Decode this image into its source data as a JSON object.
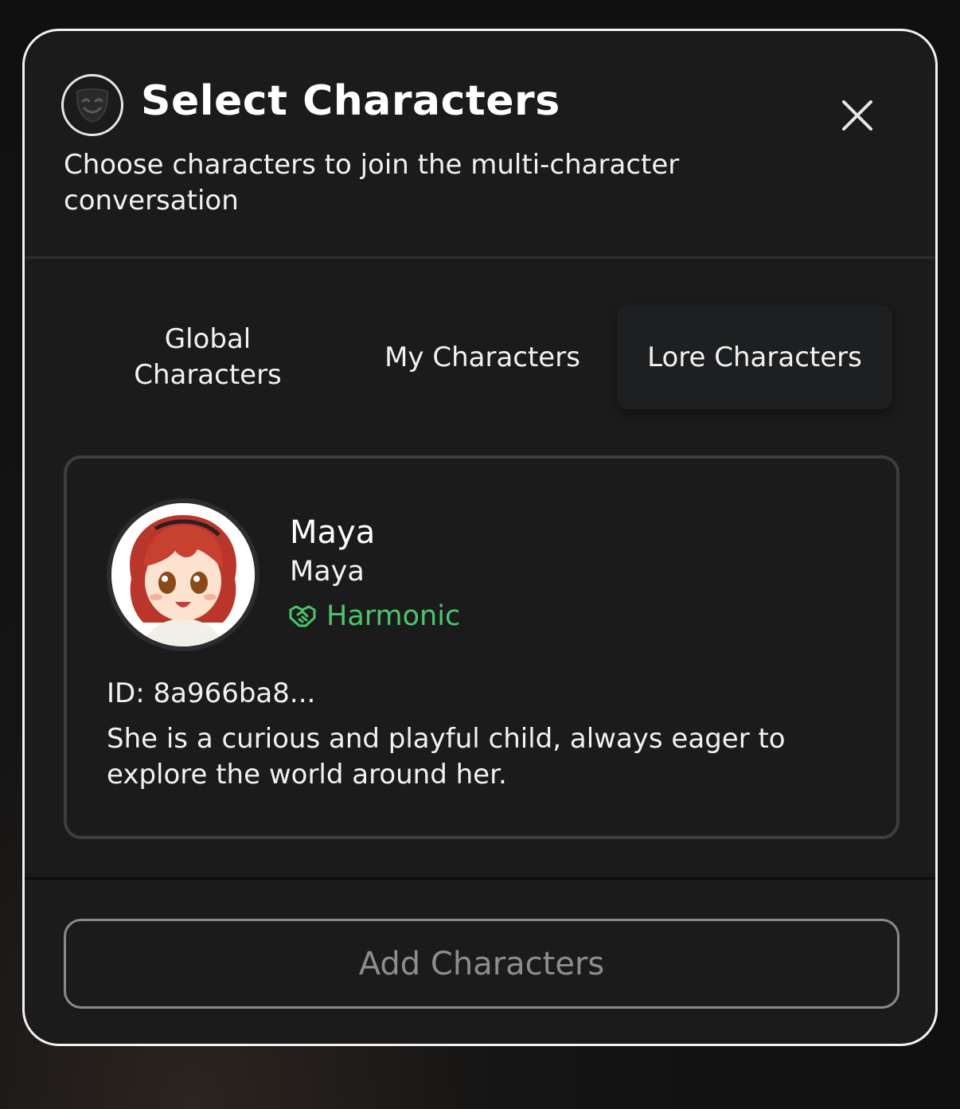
{
  "header": {
    "icon": "theater-mask-icon",
    "title": "Select Characters",
    "subtitle": "Choose characters to join the multi-character conversation",
    "close_icon": "close-icon"
  },
  "tabs": [
    {
      "label": "Global Characters",
      "active": false
    },
    {
      "label": "My Characters",
      "active": false
    },
    {
      "label": "Lore Characters",
      "active": true
    }
  ],
  "characters": [
    {
      "name": "Maya",
      "subtitle": "Maya",
      "tag": "Harmonic",
      "tag_icon": "handshake-icon",
      "tag_color": "#4cc66a",
      "id_text": "ID: 8a966ba8...",
      "description": "She is a curious and playful child, always eager to explore the world around her."
    }
  ],
  "footer": {
    "add_label": "Add Characters"
  },
  "colors": {
    "background": "#1b1b1c",
    "border": "#f2f2f2",
    "accent_green": "#4cc66a",
    "disabled_text": "#8e8e8e"
  }
}
